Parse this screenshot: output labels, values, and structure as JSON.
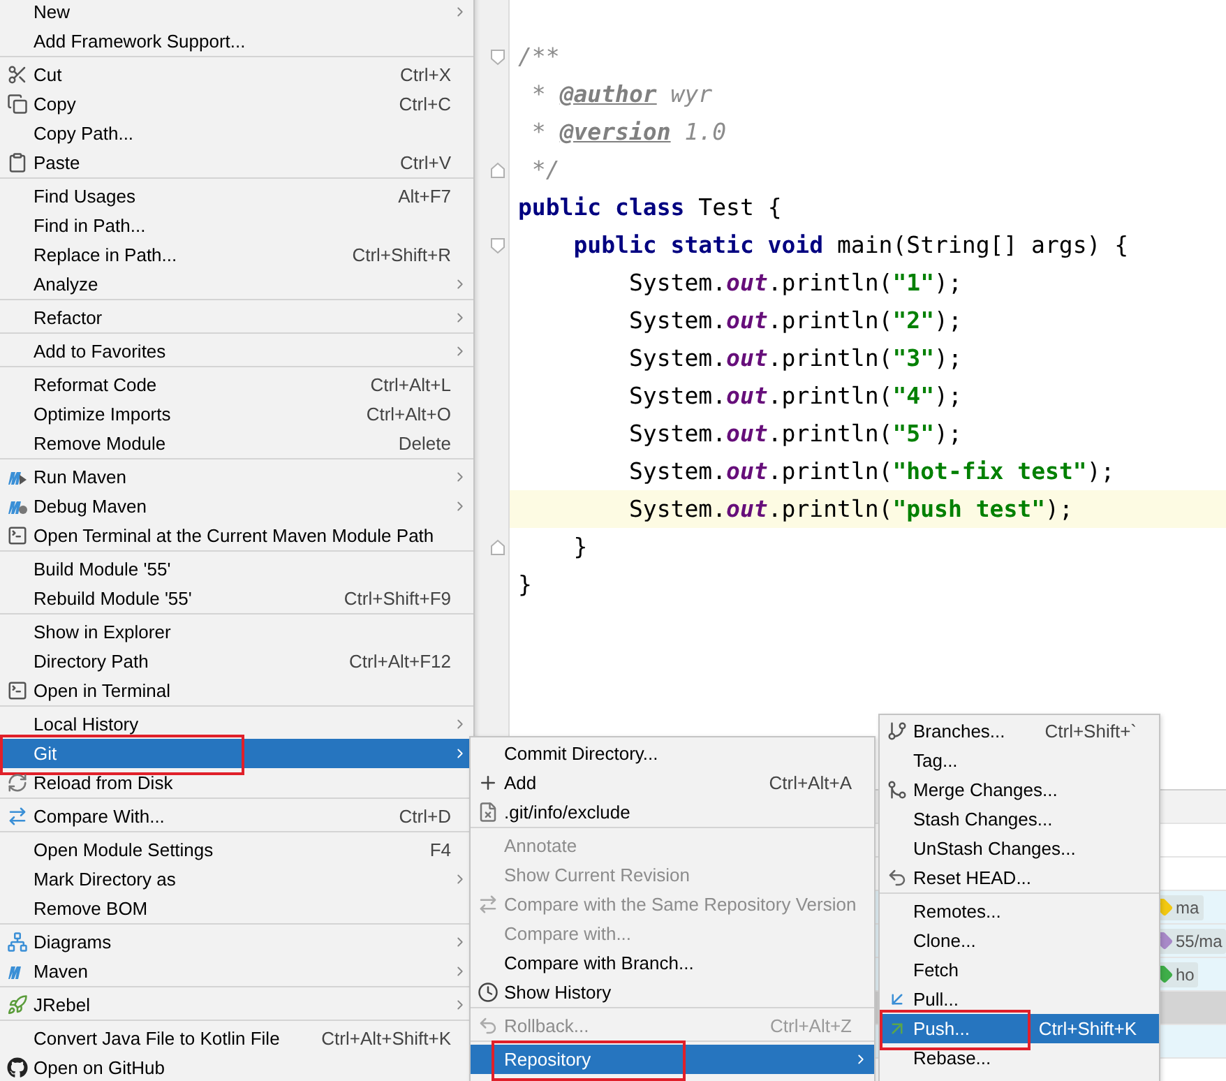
{
  "editor": {
    "lines": [
      {
        "kind": "fold-start",
        "tokens": [
          {
            "kind": "comment",
            "text": "/**"
          }
        ]
      },
      {
        "kind": "code",
        "tokens": [
          {
            "kind": "comment",
            "text": " * "
          },
          {
            "kind": "doctag",
            "text": "@author"
          },
          {
            "kind": "comment",
            "text": " wyr"
          }
        ]
      },
      {
        "kind": "code",
        "tokens": [
          {
            "kind": "comment",
            "text": " * "
          },
          {
            "kind": "doctag",
            "text": "@version"
          },
          {
            "kind": "comment",
            "text": " 1.0"
          }
        ]
      },
      {
        "kind": "fold-end",
        "tokens": [
          {
            "kind": "comment",
            "text": " */"
          }
        ]
      },
      {
        "kind": "code",
        "tokens": [
          {
            "kind": "keyword",
            "text": "public class"
          },
          {
            "kind": "plain",
            "text": " Test {"
          }
        ]
      },
      {
        "kind": "fold-start",
        "tokens": [
          {
            "kind": "keyword",
            "text": "    public static void"
          },
          {
            "kind": "plain",
            "text": " main(String[] args) {"
          }
        ]
      },
      {
        "kind": "code",
        "tokens": [
          {
            "kind": "plain",
            "text": "        System."
          },
          {
            "kind": "field",
            "text": "out"
          },
          {
            "kind": "plain",
            "text": ".println("
          },
          {
            "kind": "string",
            "text": "\"1\""
          },
          {
            "kind": "plain",
            "text": ");"
          }
        ]
      },
      {
        "kind": "code",
        "tokens": [
          {
            "kind": "plain",
            "text": "        System."
          },
          {
            "kind": "field",
            "text": "out"
          },
          {
            "kind": "plain",
            "text": ".println("
          },
          {
            "kind": "string",
            "text": "\"2\""
          },
          {
            "kind": "plain",
            "text": ");"
          }
        ]
      },
      {
        "kind": "code",
        "tokens": [
          {
            "kind": "plain",
            "text": "        System."
          },
          {
            "kind": "field",
            "text": "out"
          },
          {
            "kind": "plain",
            "text": ".println("
          },
          {
            "kind": "string",
            "text": "\"3\""
          },
          {
            "kind": "plain",
            "text": ");"
          }
        ]
      },
      {
        "kind": "code",
        "tokens": [
          {
            "kind": "plain",
            "text": "        System."
          },
          {
            "kind": "field",
            "text": "out"
          },
          {
            "kind": "plain",
            "text": ".println("
          },
          {
            "kind": "string",
            "text": "\"4\""
          },
          {
            "kind": "plain",
            "text": ");"
          }
        ]
      },
      {
        "kind": "code",
        "tokens": [
          {
            "kind": "plain",
            "text": "        System."
          },
          {
            "kind": "field",
            "text": "out"
          },
          {
            "kind": "plain",
            "text": ".println("
          },
          {
            "kind": "string",
            "text": "\"5\""
          },
          {
            "kind": "plain",
            "text": ");"
          }
        ]
      },
      {
        "kind": "code",
        "tokens": [
          {
            "kind": "plain",
            "text": "        System."
          },
          {
            "kind": "field",
            "text": "out"
          },
          {
            "kind": "plain",
            "text": ".println("
          },
          {
            "kind": "string",
            "text": "\"hot-fix test\""
          },
          {
            "kind": "plain",
            "text": ");"
          }
        ]
      },
      {
        "kind": "code",
        "current": true,
        "tokens": [
          {
            "kind": "plain",
            "text": "        System."
          },
          {
            "kind": "field",
            "text": "out"
          },
          {
            "kind": "plain",
            "text": ".println("
          },
          {
            "kind": "string",
            "text": "\"push test\""
          },
          {
            "kind": "plain",
            "text": ");"
          }
        ]
      },
      {
        "kind": "fold-end",
        "tokens": [
          {
            "kind": "plain",
            "text": "    }"
          }
        ]
      },
      {
        "kind": "code",
        "tokens": [
          {
            "kind": "plain",
            "text": "}"
          }
        ]
      }
    ]
  },
  "log": {
    "rows": [
      {
        "kind": "header"
      },
      {
        "kind": "plain"
      },
      {
        "kind": "plain"
      },
      {
        "kind": "commit",
        "tag": "ma",
        "color": "#f2c811"
      },
      {
        "kind": "commit",
        "tag": "55/ma",
        "color": "#a889c8"
      },
      {
        "kind": "commit",
        "tag": "ho",
        "color": "#3fae49"
      },
      {
        "kind": "selected"
      },
      {
        "kind": "commit"
      }
    ]
  },
  "context_menu": {
    "groups": [
      {
        "items": [
          {
            "kind": "text",
            "label": "New",
            "submenu": true
          },
          {
            "kind": "text",
            "label": "Add Framework Support..."
          }
        ]
      },
      {
        "items": [
          {
            "kind": "cut",
            "label": "Cut",
            "shortcut": "Ctrl+X"
          },
          {
            "kind": "copy",
            "label": "Copy",
            "shortcut": "Ctrl+C"
          },
          {
            "kind": "text",
            "label": "Copy Path..."
          },
          {
            "kind": "paste",
            "label": "Paste",
            "shortcut": "Ctrl+V"
          }
        ]
      },
      {
        "items": [
          {
            "kind": "text",
            "label": "Find Usages",
            "shortcut": "Alt+F7"
          },
          {
            "kind": "text",
            "label": "Find in Path..."
          },
          {
            "kind": "text",
            "label": "Replace in Path...",
            "shortcut": "Ctrl+Shift+R"
          },
          {
            "kind": "text",
            "label": "Analyze",
            "submenu": true
          }
        ]
      },
      {
        "items": [
          {
            "kind": "text",
            "label": "Refactor",
            "submenu": true
          }
        ]
      },
      {
        "items": [
          {
            "kind": "text",
            "label": "Add to Favorites",
            "submenu": true
          }
        ]
      },
      {
        "items": [
          {
            "kind": "text",
            "label": "Reformat Code",
            "shortcut": "Ctrl+Alt+L"
          },
          {
            "kind": "text",
            "label": "Optimize Imports",
            "shortcut": "Ctrl+Alt+O"
          },
          {
            "kind": "text",
            "label": "Remove Module",
            "shortcut": "Delete"
          }
        ]
      },
      {
        "items": [
          {
            "kind": "run",
            "label": "Run Maven",
            "submenu": true
          },
          {
            "kind": "debug",
            "label": "Debug Maven",
            "submenu": true
          },
          {
            "kind": "terminal",
            "label": "Open Terminal at the Current Maven Module Path"
          }
        ]
      },
      {
        "items": [
          {
            "kind": "text",
            "label": "Build Module '55'"
          },
          {
            "kind": "text",
            "label": "Rebuild Module '55'",
            "shortcut": "Ctrl+Shift+F9"
          }
        ]
      },
      {
        "items": [
          {
            "kind": "text",
            "label": "Show in Explorer"
          },
          {
            "kind": "text",
            "label": "Directory Path",
            "shortcut": "Ctrl+Alt+F12"
          },
          {
            "kind": "terminal",
            "label": "Open in Terminal"
          }
        ]
      },
      {
        "items": [
          {
            "kind": "text",
            "label": "Local History",
            "submenu": true
          },
          {
            "kind": "text",
            "label": "Git",
            "submenu": true,
            "selected": true,
            "highlighted": true
          },
          {
            "kind": "reload",
            "label": "Reload from Disk"
          }
        ]
      },
      {
        "items": [
          {
            "kind": "compare",
            "label": "Compare With...",
            "shortcut": "Ctrl+D"
          }
        ]
      },
      {
        "items": [
          {
            "kind": "text",
            "label": "Open Module Settings",
            "shortcut": "F4"
          },
          {
            "kind": "text",
            "label": "Mark Directory as",
            "submenu": true
          },
          {
            "kind": "text",
            "label": "Remove BOM"
          }
        ]
      },
      {
        "items": [
          {
            "kind": "diagram",
            "label": "Diagrams",
            "submenu": true
          },
          {
            "kind": "module",
            "label": "Maven",
            "submenu": true
          }
        ]
      },
      {
        "items": [
          {
            "kind": "rocket",
            "label": "JRebel",
            "submenu": true
          }
        ]
      },
      {
        "items": [
          {
            "kind": "text",
            "label": "Convert Java File to Kotlin File",
            "shortcut": "Ctrl+Alt+Shift+K"
          },
          {
            "kind": "hosted",
            "label": "Open on GitHub"
          }
        ]
      }
    ]
  },
  "git_menu": {
    "groups": [
      {
        "items": [
          {
            "kind": "text",
            "label": "Commit Directory..."
          },
          {
            "kind": "add",
            "label": "Add",
            "shortcut": "Ctrl+Alt+A"
          },
          {
            "kind": "file",
            "label": ".git/info/exclude"
          }
        ]
      },
      {
        "items": [
          {
            "kind": "text",
            "label": "Annotate",
            "disabled": true
          },
          {
            "kind": "text",
            "label": "Show Current Revision",
            "disabled": true
          },
          {
            "kind": "compare",
            "label": "Compare with the Same Repository Version",
            "disabled": true
          },
          {
            "kind": "text",
            "label": "Compare with...",
            "disabled": true
          },
          {
            "kind": "text",
            "label": "Compare with Branch..."
          },
          {
            "kind": "history",
            "label": "Show History"
          }
        ]
      },
      {
        "items": [
          {
            "kind": "undo",
            "label": "Rollback...",
            "shortcut": "Ctrl+Alt+Z",
            "disabled": true
          }
        ]
      },
      {
        "items": [
          {
            "kind": "text",
            "label": "Repository",
            "submenu": true,
            "selected": true,
            "highlighted": true
          }
        ]
      }
    ]
  },
  "repository_menu": {
    "groups": [
      {
        "items": [
          {
            "kind": "branch",
            "label": "Branches...",
            "shortcut": "Ctrl+Shift+`"
          },
          {
            "kind": "text",
            "label": "Tag..."
          },
          {
            "kind": "merge",
            "label": "Merge Changes..."
          },
          {
            "kind": "text",
            "label": "Stash Changes..."
          },
          {
            "kind": "text",
            "label": "UnStash Changes..."
          },
          {
            "kind": "undo",
            "label": "Reset HEAD..."
          }
        ]
      },
      {
        "items": [
          {
            "kind": "text",
            "label": "Remotes..."
          },
          {
            "kind": "text",
            "label": "Clone..."
          },
          {
            "kind": "text",
            "label": "Fetch"
          },
          {
            "kind": "incoming",
            "label": "Pull..."
          },
          {
            "kind": "outgoing",
            "label": "Push...",
            "shortcut": "Ctrl+Shift+K",
            "selected": true,
            "highlighted": true
          },
          {
            "kind": "text",
            "label": "Rebase..."
          }
        ]
      }
    ]
  }
}
